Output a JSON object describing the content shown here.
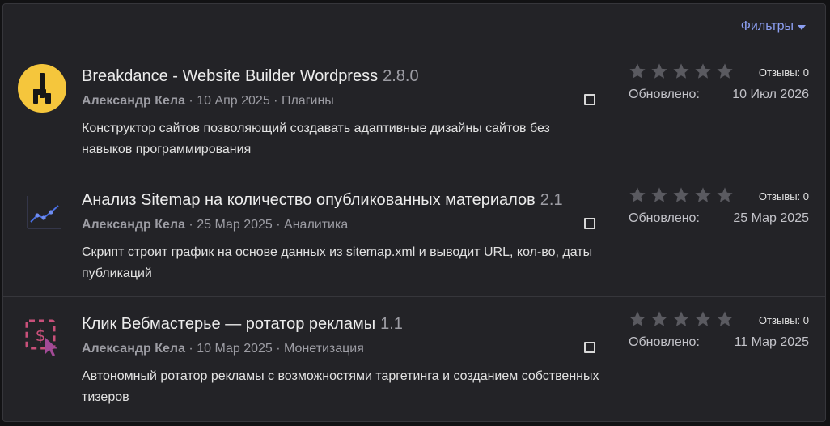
{
  "filter": {
    "label": "Фильтры"
  },
  "items": [
    {
      "icon": "breakdance-logo-icon",
      "title": "Breakdance - Website Builder Wordpress",
      "version": "2.8.0",
      "author": "Александр Кела",
      "date": "10 Апр 2025",
      "category": "Плагины",
      "description": "Конструктор сайтов позволяющий создавать адаптивные дизайны сайтов без навыков программирования",
      "rating": 0,
      "reviews": "Отзывы: 0",
      "updated_label": "Обновлено:",
      "updated_date": "10 Июл 2026"
    },
    {
      "icon": "line-chart-icon",
      "title": "Анализ Sitemap на количество опубликованных материалов",
      "version": "2.1",
      "author": "Александр Кела",
      "date": "25 Мар 2025",
      "category": "Аналитика",
      "description": "Скрипт строит график на основе данных из sitemap.xml и выводит URL, кол-во, даты публикаций",
      "rating": 0,
      "reviews": "Отзывы: 0",
      "updated_label": "Обновлено:",
      "updated_date": "25 Мар 2025"
    },
    {
      "icon": "dollar-click-icon",
      "title": "Клик Вебмастерье — ротатор рекламы",
      "version": "1.1",
      "author": "Александр Кела",
      "date": "10 Мар 2025",
      "category": "Монетизация",
      "description": "Автономный ротатор рекламы с возможностями таргетинга и созданием собственных тизеров",
      "rating": 0,
      "reviews": "Отзывы: 0",
      "updated_label": "Обновлено:",
      "updated_date": "11 Мар 2025"
    }
  ],
  "colors": {
    "panel_bg": "#232327",
    "accent": "#8c9ff2",
    "breakdance_yellow": "#f5c63c",
    "chart_blue": "#4a6fe3",
    "dollar_pink": "#c8507a"
  }
}
